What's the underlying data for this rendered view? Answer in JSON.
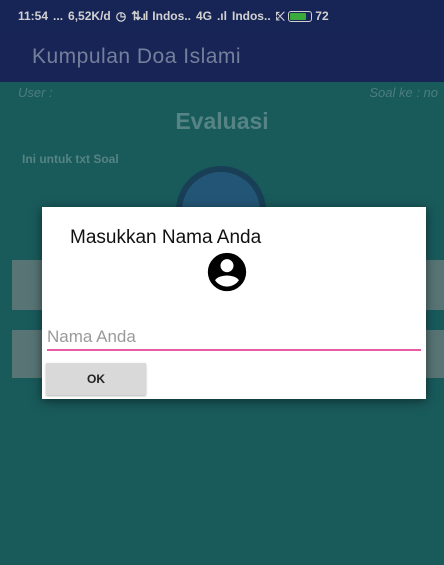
{
  "status_bar": {
    "time": "11:54",
    "dots": "...",
    "speed": "6,52K/d",
    "carrier1": "Indos..",
    "network": "4G",
    "carrier2": "Indos..",
    "battery_pct": "72",
    "battery_level": 0.72
  },
  "app_bar": {
    "title": "Kumpulan Doa Islami"
  },
  "content": {
    "user_label": "User :",
    "soal_label": "Soal ke : no",
    "heading": "Evaluasi",
    "soal_text": "Ini untuk txt Soal"
  },
  "dialog": {
    "title": "Masukkan Nama Anda",
    "name_input": {
      "value": "",
      "placeholder": "Nama Anda"
    },
    "ok_label": "OK"
  },
  "colors": {
    "status_bar_bg": "#1d2c69",
    "app_bar_bg": "#1f2d6a",
    "content_bg": "#1f6e6f",
    "accent_pink": "#e85ca6",
    "battery_green": "#49d04a"
  },
  "icons": [
    "alarm-icon",
    "signal-icon",
    "battery-icon",
    "question-icon",
    "account-circle-icon"
  ]
}
